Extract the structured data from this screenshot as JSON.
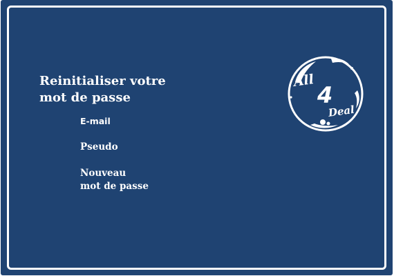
{
  "form": {
    "title_line1": "Reinitialiser votre",
    "title_line2": "mot de passe",
    "email_label": "E-mail",
    "pseudo_label": "Pseudo",
    "password_label_line1": "Nouveau",
    "password_label_line2": "mot de passe"
  },
  "logo": {
    "word_top": "All",
    "number": "4",
    "word_bottom": "Deal"
  },
  "colors": {
    "panel_background": "#1f4372",
    "border": "#ffffff",
    "text": "#ffffff"
  }
}
